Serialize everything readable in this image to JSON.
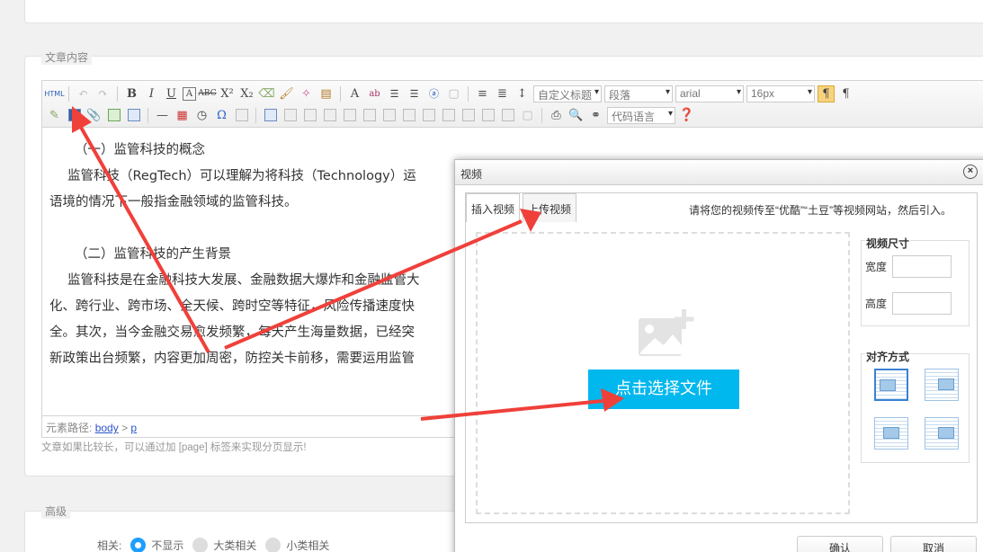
{
  "section": {
    "title": "文章内容"
  },
  "toolbar": {
    "html_label": "HTML",
    "heading_select": "自定义标题",
    "paragraph_select": "段落",
    "font_select": "arial",
    "size_select": "16px",
    "code_lang_select": "代码语言"
  },
  "editor": {
    "lines": [
      "（一）监管科技的概念",
      "监管科技（RegTech）可以理解为将科技（Technology）运",
      "语境的情况下一般指金融领域的监管科技。",
      "",
      "（二）监管科技的产生背景",
      "监管科技是在金融科技大发展、金融数据大爆炸和金融监管大",
      "化、跨行业、跨市场、全天候、跨时空等特征，风险传播速度快",
      "全。其次，当今金融交易愈发频繁，每天产生海量数据，已经突",
      "新政策出台频繁，内容更加周密，防控关卡前移，需要运用监管"
    ],
    "path_label": "元素路径:",
    "path_body": "body",
    "path_sep": ">",
    "path_p": "p"
  },
  "hint": "文章如果比较长，可以通过加 [page] 标签来实现分页显示!",
  "advanced": {
    "title": "高级",
    "related_label": "相关:",
    "options": [
      "不显示",
      "大类相关",
      "小类相关"
    ],
    "selected_index": 0
  },
  "dialog": {
    "title": "视频",
    "close": "×",
    "tabs": [
      "插入视频",
      "上传视频"
    ],
    "active_tab": 1,
    "note": "请将您的视频传至“优酷”“土豆”等视频网站，然后引入。",
    "pick_button": "点击选择文件",
    "size_title": "视频尺寸",
    "width_label": "宽度",
    "height_label": "高度",
    "width_value": "",
    "height_value": "",
    "align_title": "对齐方式",
    "confirm": "确认",
    "cancel": "取消"
  },
  "colors": {
    "accent": "#00b7ee",
    "arrow": "#f0403a",
    "radio_on": "#1e9fff"
  }
}
